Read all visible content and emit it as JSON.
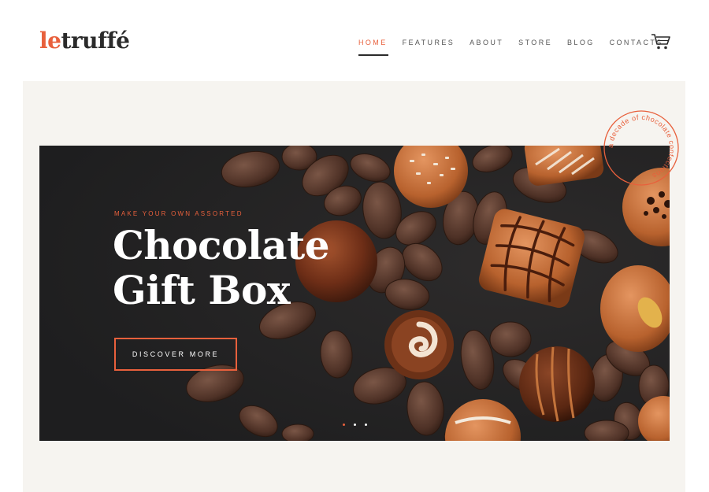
{
  "brand": {
    "logo_prefix": "le",
    "logo_rest": "truffé"
  },
  "nav": {
    "items": [
      {
        "label": "HOME",
        "active": true
      },
      {
        "label": "FEATURES"
      },
      {
        "label": "ABOUT"
      },
      {
        "label": "STORE"
      },
      {
        "label": "BLOG"
      },
      {
        "label": "CONTACTS"
      }
    ],
    "cart_icon": "shopping-cart-icon"
  },
  "hero": {
    "pretitle": "MAKE YOUR OWN ASSORTED",
    "title_line1": "Chocolate",
    "title_line2": "Gift Box",
    "cta_label": "DISCOVER MORE",
    "slides_total": 3,
    "active_slide": 1
  },
  "badge": {
    "text": "a decade of chocolate confections"
  },
  "colors": {
    "accent": "#e8603c",
    "dark": "#252526",
    "text": "#2b2b2b",
    "panel": "#f6f4f0"
  }
}
